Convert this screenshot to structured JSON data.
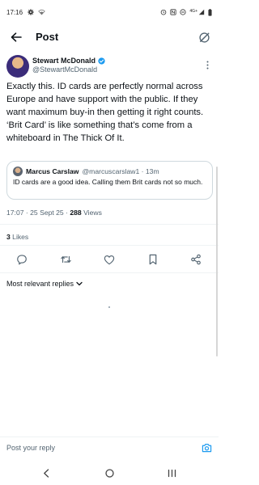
{
  "status_bar": {
    "time": "17:16",
    "left_icons": [
      "gear-icon",
      "wifi-icon"
    ],
    "right_icons": [
      "alarm-icon",
      "notification-icon",
      "do-not-disturb-icon",
      "signal-icon",
      "battery-icon"
    ],
    "network_label": "4G+"
  },
  "header": {
    "title": "Post",
    "back_icon": "arrow-left-icon",
    "action_icon": "grok-icon"
  },
  "tweet": {
    "author_name": "Stewart McDonald",
    "author_handle": "@StewartMcDonald",
    "verified_icon": "verified-badge-icon",
    "text": "Exactly this. ID cards are perfectly normal across Europe and have support with the public. If they want maximum buy-in then getting it right counts. ‘Brit Card’ is like something that’s come from a whiteboard in The Thick Of It.",
    "timestamp": "17:07 · 25 Sept 25 ·",
    "views_count": "288",
    "views_label": "Views",
    "likes_count": "3",
    "likes_label": "Likes"
  },
  "quote": {
    "author_name": "Marcus Carslaw",
    "author_handle": "@marcuscarslaw1 · 13m",
    "text": "ID cards are a good idea. Calling them Brit cards not so much."
  },
  "actions": [
    "reply-icon",
    "retweet-icon",
    "like-icon",
    "bookmark-icon",
    "share-icon"
  ],
  "replies": {
    "sort_label": "Most relevant replies"
  },
  "composer": {
    "placeholder": "Post your reply"
  },
  "nav_bar": [
    "back-nav-icon",
    "home-nav-icon",
    "recents-nav-icon"
  ],
  "colors": {
    "accent": "#1d9bf0",
    "text": "#0f1419",
    "secondary_text": "#536471",
    "divider": "#eff3f4"
  }
}
